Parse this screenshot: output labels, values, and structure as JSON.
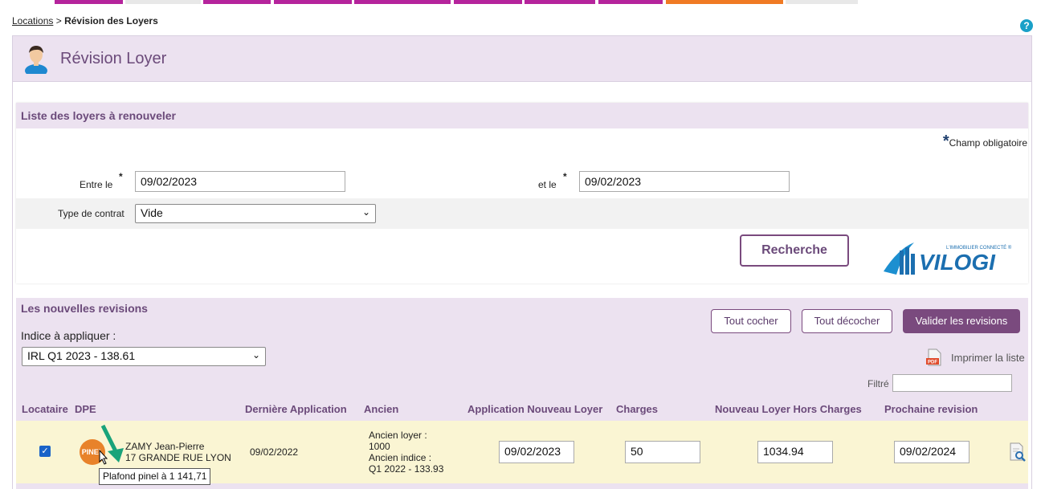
{
  "topnav_colors": [
    "#b5249c",
    "#e8e8e8",
    "#b5249c",
    "#b5249c",
    "#b5249c",
    "#b5249c",
    "#b5249c",
    "#b5249c",
    "#f07a24",
    "#e8e8e8"
  ],
  "breadcrumb": {
    "link": "Locations",
    "separator": " > ",
    "current": "Révision des Loyers"
  },
  "help_label": "?",
  "page_title": "Révision Loyer",
  "search_panel": {
    "title": "Liste des loyers à renouveler",
    "required_note": "Champ obligatoire",
    "required_star": "*",
    "between_label": "Entre le",
    "between_value": "09/02/2023",
    "and_label": "et le",
    "and_value": "09/02/2023",
    "contract_type_label": "Type de contrat",
    "contract_type_value": "Vide",
    "search_button": "Recherche"
  },
  "logo": {
    "tagline": "L'IMMOBILIER CONNECTÉ ®",
    "name": "VILOGI"
  },
  "revisions_panel": {
    "title": "Les nouvelles revisions",
    "index_label": "Indice à appliquer :",
    "index_value": "IRL Q1 2023 - 138.61",
    "check_all": "Tout cocher",
    "uncheck_all": "Tout décocher",
    "validate": "Valider les revisions",
    "print_list": "Imprimer la liste",
    "pdf_label": "PDF",
    "filter_label": "Filtré",
    "filter_value": ""
  },
  "table": {
    "headers": {
      "locataire": "Locataire",
      "dpe": "DPE",
      "last_application": "Dernière Application",
      "ancien": "Ancien",
      "new_application": "Application Nouveau Loyer",
      "charges": "Charges",
      "new_rent": "Nouveau Loyer Hors Charges",
      "next_revision": "Prochaine revision"
    },
    "rows": [
      {
        "checked": "✓",
        "pinel_badge": "PINEL",
        "tenant_name": "ZAMY Jean-Pierre",
        "tenant_address": "17 GRANDE RUE LYON",
        "last_application": "09/02/2022",
        "old_rent_label": "Ancien loyer :",
        "old_rent_value": "1000",
        "old_index_label": "Ancien indice :",
        "old_index_value": "Q1 2022 - 133.93",
        "new_application": "09/02/2023",
        "charges": "50",
        "new_rent": "1034.94",
        "next_revision": "09/02/2024"
      }
    ],
    "tooltip": "Plafond pinel à 1 141,71"
  }
}
